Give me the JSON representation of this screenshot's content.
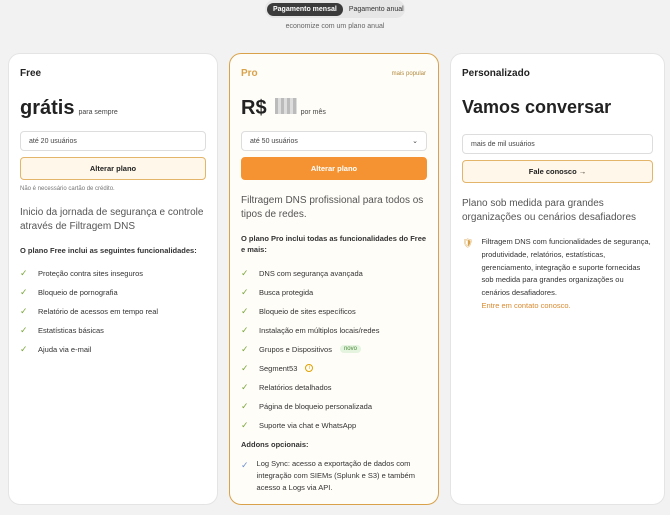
{
  "billing": {
    "monthly": "Pagamento mensal",
    "annual": "Pagamento anual",
    "note": "economize com um plano anual"
  },
  "free": {
    "name": "Free",
    "price": "grátis",
    "price_suffix": "para sempre",
    "select": "até 20 usuários",
    "button": "Alterar plano",
    "tiny": "Não é necessário cartão de crédito.",
    "desc": "Inicio da jornada de segurança e controle através de Filtragem DNS",
    "feat_head": "O plano Free inclui as seguintes funcionalidades:",
    "features": [
      "Proteção contra sites inseguros",
      "Bloqueio de pornografia",
      "Relatório de acessos em tempo real",
      "Estatísticas básicas",
      "Ajuda via e-mail"
    ]
  },
  "pro": {
    "name": "Pro",
    "badge": "mais popular",
    "price": "R$",
    "price_suffix": "por mês",
    "select": "até 50 usuários",
    "button": "Alterar plano",
    "desc": "Filtragem DNS profissional para todos os tipos de redes.",
    "feat_head": "O plano Pro inclui todas as funcionalidades do Free e mais:",
    "features": [
      "DNS com segurança avançada",
      "Busca protegida",
      "Bloqueio de sites específicos",
      "Instalação em múltiplos locais/redes",
      "Grupos e Dispositivos",
      "Segment53",
      "Relatórios detalhados",
      "Página de bloqueio personalizada",
      "Suporte via chat e WhatsApp"
    ],
    "new_label": "novo",
    "addons_head": "Addons opcionais:",
    "addon": "Log Sync: acesso a exportação de dados com integração com SIEMs (Splunk e S3) e também acesso a Logs via API."
  },
  "custom": {
    "name": "Personalizado",
    "title": "Vamos conversar",
    "select": "mais de mil usuários",
    "button": "Fale conosco →",
    "desc": "Plano sob medida para grandes organizações ou cenários desafiadores",
    "shield_text": "Filtragem DNS com funcionalidades de segurança, produtividade, relatórios, estatísticas, gerenciamento, integração e suporte fornecidas sob medida para grandes organizações ou cenários desafiadores.",
    "link": "Entre em contato conosco."
  }
}
